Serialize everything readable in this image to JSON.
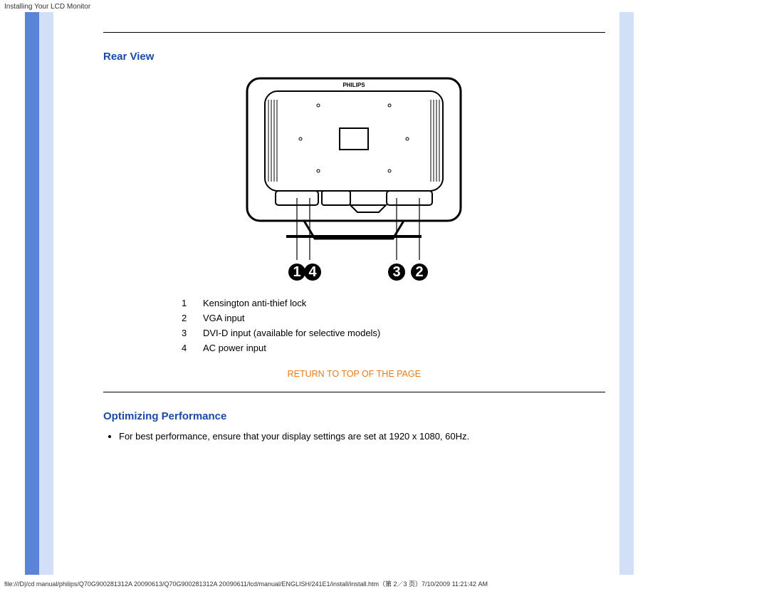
{
  "header": {
    "title": "Installing Your LCD Monitor"
  },
  "sections": {
    "rear_view": {
      "heading": "Rear View",
      "brand_label": "PHILIPS",
      "callouts": [
        "1",
        "4",
        "3",
        "2"
      ],
      "legend": [
        {
          "num": "1",
          "text": "Kensington anti-thief lock"
        },
        {
          "num": "2",
          "text": "VGA input"
        },
        {
          "num": "3",
          "text": "DVI-D input (available for selective models)"
        },
        {
          "num": "4",
          "text": "AC power input"
        }
      ]
    },
    "return_link": "RETURN TO TOP OF THE PAGE",
    "optimizing": {
      "heading": "Optimizing Performance",
      "items": [
        "For best performance, ensure that your display settings are set at 1920 x 1080, 60Hz."
      ]
    }
  },
  "footer": {
    "text": "file:///D|/cd manual/philips/Q70G900281312A 20090613/Q70G900281312A 20090611/lcd/manual/ENGLISH/241E1/install/install.htm（第 2／3 页）7/10/2009 11:21:42 AM"
  }
}
